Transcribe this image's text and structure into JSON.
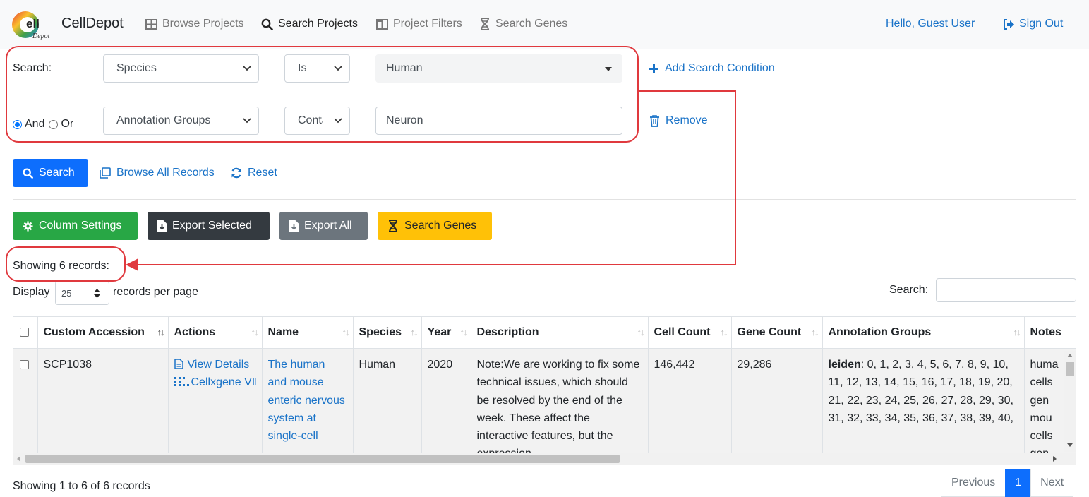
{
  "brand": {
    "name": "CellDepot",
    "logo_text": "Cell Depot"
  },
  "nav": {
    "items": [
      {
        "label": "Browse Projects",
        "icon": "table-icon"
      },
      {
        "label": "Search Projects",
        "icon": "search-icon",
        "active": true
      },
      {
        "label": "Project Filters",
        "icon": "columns-icon"
      },
      {
        "label": "Search Genes",
        "icon": "dna-icon"
      }
    ],
    "greeting": "Hello, Guest User",
    "signout": "Sign Out"
  },
  "search": {
    "label": "Search:",
    "row1": {
      "field": "Species",
      "operator": "Is",
      "value": "Human"
    },
    "row2": {
      "field": "Annotation Groups",
      "operator": "Conta",
      "value": "Neuron"
    },
    "logic": {
      "and": "And",
      "or": "Or",
      "selected": "And"
    },
    "add_condition": "Add Search Condition",
    "remove": "Remove",
    "search_button": "Search",
    "browse_all": "Browse All Records",
    "reset": "Reset"
  },
  "toolbar": {
    "column_settings": "Column Settings",
    "export_selected": "Export Selected",
    "export_all": "Export All",
    "search_genes": "Search Genes"
  },
  "results": {
    "showing": "Showing 6 records:",
    "display_label": "Display",
    "page_size": "25",
    "per_page": "records per page",
    "search_label": "Search:",
    "search_value": ""
  },
  "table": {
    "headers": [
      "",
      "Custom Accession",
      "Actions",
      "Name",
      "Species",
      "Year",
      "Description",
      "Cell Count",
      "Gene Count",
      "Annotation Groups",
      "Notes"
    ],
    "row": {
      "accession": "SCP1038",
      "action_view": "View Details",
      "action_cellxgene": "Cellxgene VIP",
      "name": "The human and mouse enteric nervous system at single-cell",
      "species": "Human",
      "year": "2020",
      "description": "Note:We are working to fix some technical issues, which should be resolved by the end of the week. These affect the interactive features, but the expression",
      "cell_count": "146,442",
      "gene_count": "29,286",
      "annotation_key": "leiden",
      "annotation_values": ": 0, 1, 2, 3, 4, 5, 6, 7, 8, 9, 10, 11, 12, 13, 14, 15, 16, 17, 18, 19, 20, 21, 22, 23, 24, 25, 26, 27, 28, 29, 30, 31, 32, 33, 34, 35, 36, 37, 38, 39, 40,",
      "notes": "human cells gen mou cells gen"
    }
  },
  "footer": {
    "summary": "Showing 1 to 6 of 6 records",
    "previous": "Previous",
    "page": "1",
    "next": "Next"
  },
  "colors": {
    "accent": "#0d6efd",
    "annotation": "#e0393e",
    "link": "#1a73c8"
  }
}
